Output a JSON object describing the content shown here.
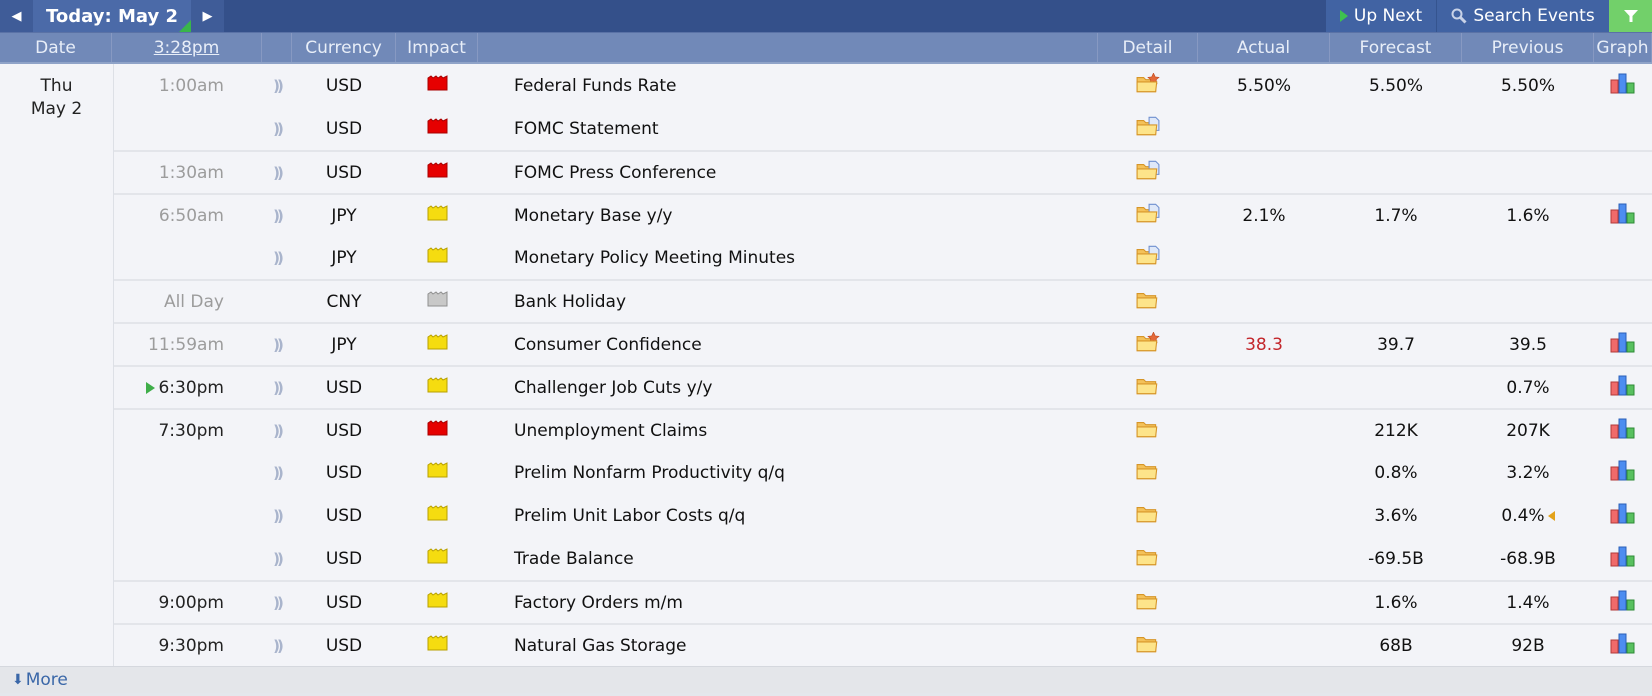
{
  "topbar": {
    "prev_label": "◀",
    "today_label": "Today: May 2",
    "next_label": "▶",
    "upnext_label": "Up Next",
    "search_label": "Search Events"
  },
  "headers": {
    "date": "Date",
    "time": "3:28pm",
    "currency": "Currency",
    "impact": "Impact",
    "event": "",
    "detail": "Detail",
    "actual": "Actual",
    "forecast": "Forecast",
    "previous": "Previous",
    "graph": "Graph"
  },
  "day": {
    "weekday": "Thu",
    "date": "May 2"
  },
  "colors": {
    "high": "#e00000",
    "medium": "#f2d600",
    "holiday": "#bdbdbd",
    "accent": "#34508a",
    "filter": "#72d06a"
  },
  "events": [
    {
      "time": "1:00am",
      "past": true,
      "sound": true,
      "currency": "USD",
      "impact": "high",
      "name": "Federal Funds Rate",
      "detail": "star",
      "actual": "5.50%",
      "actual_red": false,
      "forecast": "5.50%",
      "previous": "5.50%",
      "revised": false,
      "graph": true,
      "sep": false
    },
    {
      "time": "",
      "past": true,
      "sound": true,
      "currency": "USD",
      "impact": "high",
      "name": "FOMC Statement",
      "detail": "doc",
      "actual": "",
      "actual_red": false,
      "forecast": "",
      "previous": "",
      "revised": false,
      "graph": false,
      "sep": false
    },
    {
      "time": "1:30am",
      "past": true,
      "sound": true,
      "currency": "USD",
      "impact": "high",
      "name": "FOMC Press Conference",
      "detail": "doc",
      "actual": "",
      "actual_red": false,
      "forecast": "",
      "previous": "",
      "revised": false,
      "graph": false,
      "sep": true
    },
    {
      "time": "6:50am",
      "past": true,
      "sound": true,
      "currency": "JPY",
      "impact": "medium",
      "name": "Monetary Base y/y",
      "detail": "doc",
      "actual": "2.1%",
      "actual_red": false,
      "forecast": "1.7%",
      "previous": "1.6%",
      "revised": false,
      "graph": true,
      "sep": true
    },
    {
      "time": "",
      "past": true,
      "sound": true,
      "currency": "JPY",
      "impact": "medium",
      "name": "Monetary Policy Meeting Minutes",
      "detail": "doc",
      "actual": "",
      "actual_red": false,
      "forecast": "",
      "previous": "",
      "revised": false,
      "graph": false,
      "sep": false
    },
    {
      "time": "All Day",
      "past": true,
      "sound": false,
      "currency": "CNY",
      "impact": "holiday",
      "name": "Bank Holiday",
      "detail": "folder",
      "actual": "",
      "actual_red": false,
      "forecast": "",
      "previous": "",
      "revised": false,
      "graph": false,
      "sep": true
    },
    {
      "time": "11:59am",
      "past": true,
      "sound": true,
      "currency": "JPY",
      "impact": "medium",
      "name": "Consumer Confidence",
      "detail": "star",
      "actual": "38.3",
      "actual_red": true,
      "forecast": "39.7",
      "previous": "39.5",
      "revised": false,
      "graph": true,
      "sep": true
    },
    {
      "time": "6:30pm",
      "past": false,
      "next": true,
      "sound": true,
      "currency": "USD",
      "impact": "medium",
      "name": "Challenger Job Cuts y/y",
      "detail": "folder",
      "actual": "",
      "actual_red": false,
      "forecast": "",
      "previous": "0.7%",
      "revised": false,
      "graph": true,
      "sep": true
    },
    {
      "time": "7:30pm",
      "past": false,
      "sound": true,
      "currency": "USD",
      "impact": "high",
      "name": "Unemployment Claims",
      "detail": "folder",
      "actual": "",
      "actual_red": false,
      "forecast": "212K",
      "previous": "207K",
      "revised": false,
      "graph": true,
      "sep": true
    },
    {
      "time": "",
      "past": false,
      "sound": true,
      "currency": "USD",
      "impact": "medium",
      "name": "Prelim Nonfarm Productivity q/q",
      "detail": "folder",
      "actual": "",
      "actual_red": false,
      "forecast": "0.8%",
      "previous": "3.2%",
      "revised": false,
      "graph": true,
      "sep": false
    },
    {
      "time": "",
      "past": false,
      "sound": true,
      "currency": "USD",
      "impact": "medium",
      "name": "Prelim Unit Labor Costs q/q",
      "detail": "folder",
      "actual": "",
      "actual_red": false,
      "forecast": "3.6%",
      "previous": "0.4%",
      "revised": true,
      "graph": true,
      "sep": false
    },
    {
      "time": "",
      "past": false,
      "sound": true,
      "currency": "USD",
      "impact": "medium",
      "name": "Trade Balance",
      "detail": "folder",
      "actual": "",
      "actual_red": false,
      "forecast": "-69.5B",
      "previous": "-68.9B",
      "revised": false,
      "graph": true,
      "sep": false
    },
    {
      "time": "9:00pm",
      "past": false,
      "sound": true,
      "currency": "USD",
      "impact": "medium",
      "name": "Factory Orders m/m",
      "detail": "folder",
      "actual": "",
      "actual_red": false,
      "forecast": "1.6%",
      "previous": "1.4%",
      "revised": false,
      "graph": true,
      "sep": true
    },
    {
      "time": "9:30pm",
      "past": false,
      "sound": true,
      "currency": "USD",
      "impact": "medium",
      "name": "Natural Gas Storage",
      "detail": "folder",
      "actual": "",
      "actual_red": false,
      "forecast": "68B",
      "previous": "92B",
      "revised": false,
      "graph": true,
      "sep": true
    }
  ],
  "footer": {
    "more_label": "More"
  }
}
